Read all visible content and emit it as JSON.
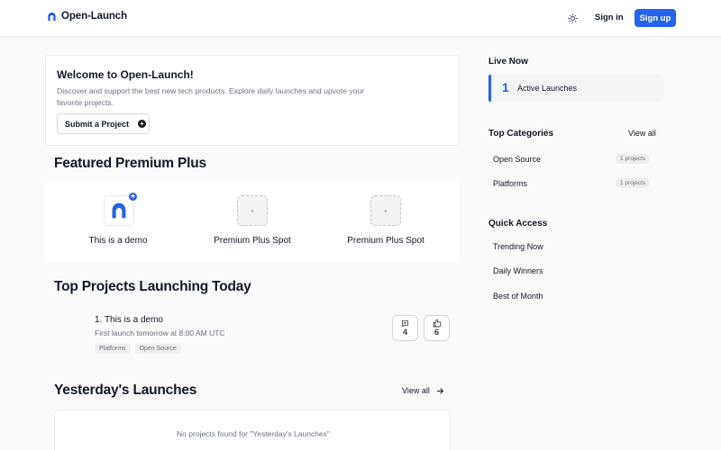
{
  "header": {
    "brand": "Open-Launch",
    "theme_icon": "sun-icon",
    "signin_label": "Sign in",
    "signup_label": "Sign up",
    "accent": "#2563eb"
  },
  "welcome": {
    "title": "Welcome to Open-Launch!",
    "description": "Discover and support the best new tech products. Explore daily launches and upvote your favorite projects.",
    "submit_label": "Submit a Project",
    "submit_icon": "plus-circle-icon"
  },
  "featured": {
    "title": "Featured Premium Plus",
    "items": [
      {
        "label": "This is a demo",
        "icon": "open-launch-logo-icon",
        "badge_icon": "star-icon"
      },
      {
        "label": "Premium Plus Spot",
        "icon": "plus-icon",
        "glyph": "+"
      },
      {
        "label": "Premium Plus Spot",
        "icon": "plus-icon",
        "glyph": "+"
      }
    ]
  },
  "today": {
    "title": "Top Projects Launching Today",
    "projects": [
      {
        "name": "1. This is a demo",
        "subtitle": "First launch tomorrow at 8:00 AM UTC",
        "tags": [
          "Platforms",
          "Open Source"
        ],
        "comments": "4",
        "upvotes": "6"
      }
    ]
  },
  "yesterday": {
    "title": "Yesterday's Launches",
    "view_all_label": "View all",
    "empty_text": "No projects found for \"Yesterday's Launches\""
  },
  "sidebar": {
    "live_title": "Live Now",
    "live_count": "1",
    "live_label": "Active Launches",
    "categories_title": "Top Categories",
    "categories_view_all": "View all",
    "categories": [
      {
        "name": "Open Source",
        "count": "1 projects"
      },
      {
        "name": "Platforms",
        "count": "1 projects"
      }
    ],
    "quick_title": "Quick Access",
    "quick_links": [
      "Trending Now",
      "Daily Winners",
      "Best of Month"
    ]
  }
}
